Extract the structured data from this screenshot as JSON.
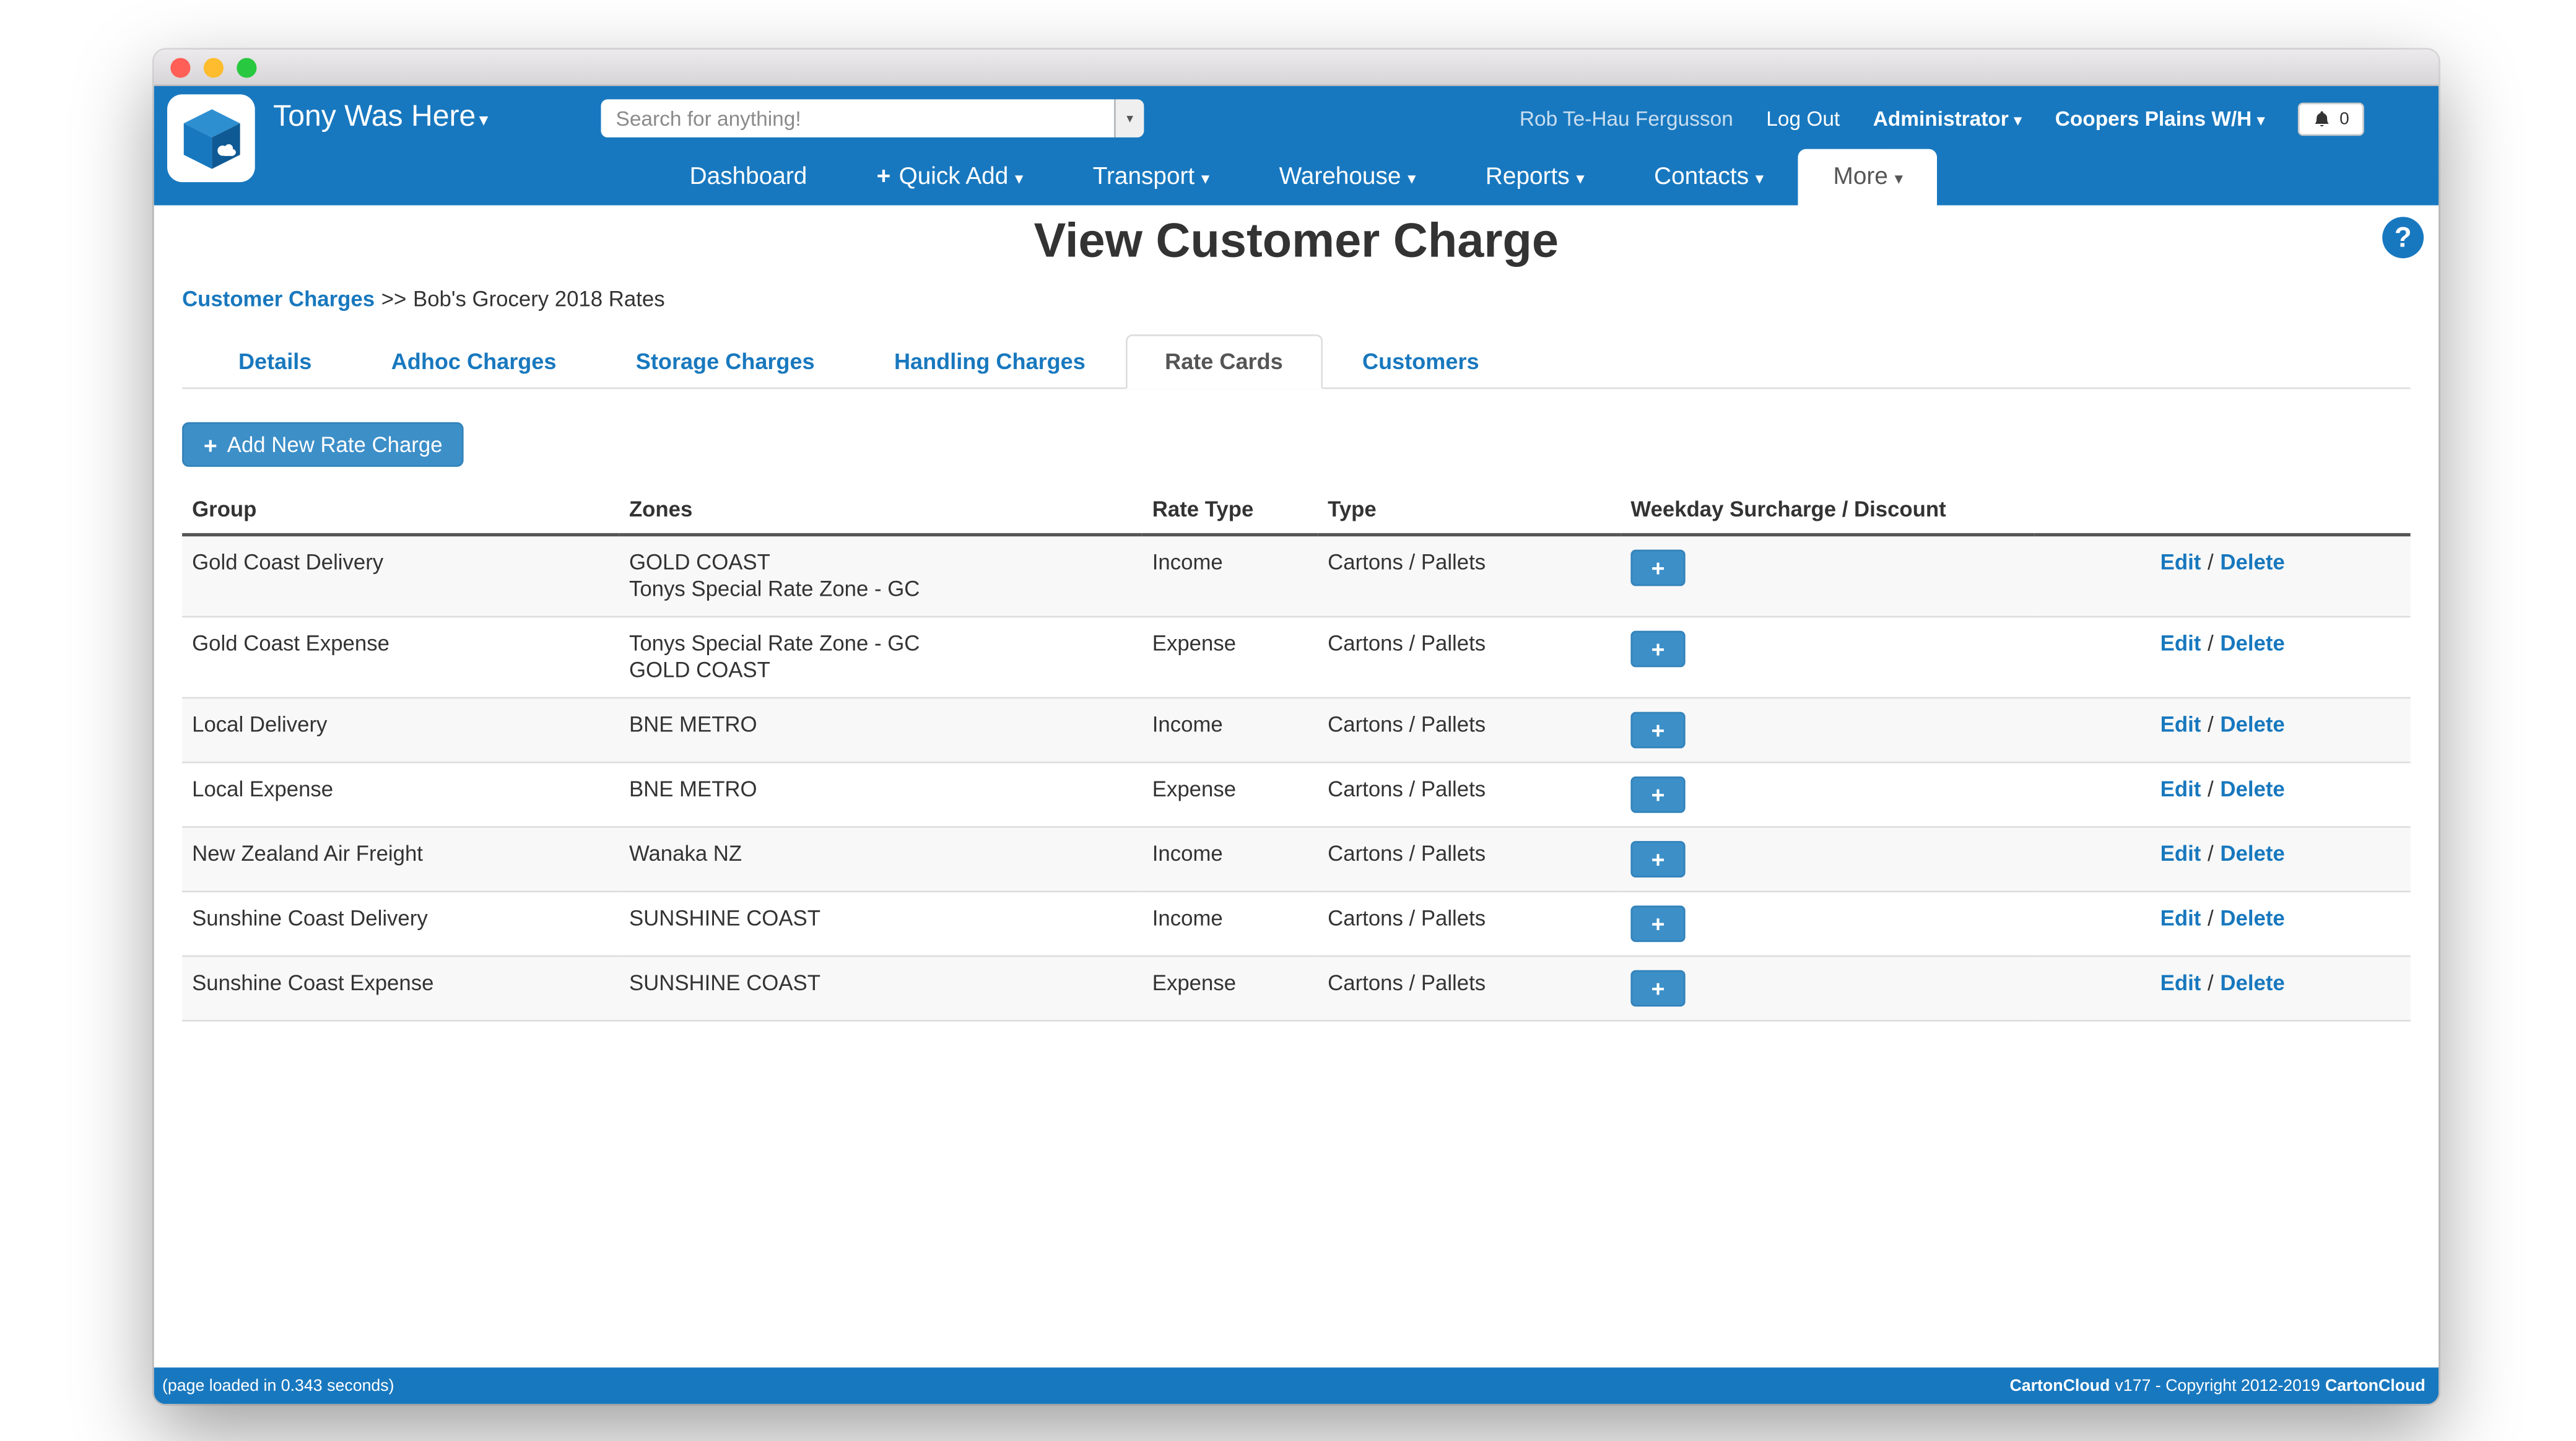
{
  "icons": {
    "caret_down": "▾",
    "plus": "+",
    "question_mark": "?"
  },
  "colors": {
    "header_blue": "#1878bf",
    "link_blue": "#1878be",
    "button_blue": "#3d8fc8"
  },
  "header": {
    "brand": "Tony Was Here",
    "search_placeholder": "Search for anything!",
    "user_name": "Rob Te-Hau Fergusson",
    "log_out_label": "Log Out",
    "role_label": "Administrator",
    "warehouse_label": "Coopers Plains W/H",
    "notification_count": "0"
  },
  "nav": {
    "items": [
      {
        "label": "Dashboard"
      },
      {
        "label": "Quick Add"
      },
      {
        "label": "Transport"
      },
      {
        "label": "Warehouse"
      },
      {
        "label": "Reports"
      },
      {
        "label": "Contacts"
      },
      {
        "label": "More"
      }
    ]
  },
  "page": {
    "title": "View Customer Charge",
    "breadcrumb": {
      "link": "Customer Charges",
      "separator": ">>",
      "current": "Bob's Grocery 2018 Rates"
    },
    "tabs": [
      {
        "label": "Details"
      },
      {
        "label": "Adhoc Charges"
      },
      {
        "label": "Storage Charges"
      },
      {
        "label": "Handling Charges"
      },
      {
        "label": "Rate Cards"
      },
      {
        "label": "Customers"
      }
    ],
    "add_button_label": "Add New Rate Charge",
    "table": {
      "headers": [
        "Group",
        "Zones",
        "Rate Type",
        "Type",
        "Weekday Surcharge / Discount",
        ""
      ],
      "rows": [
        {
          "group": "Gold Coast Delivery",
          "zones": [
            "GOLD COAST",
            "Tonys Special Rate Zone - GC"
          ],
          "rate_type": "Income",
          "type": "Cartons / Pallets"
        },
        {
          "group": "Gold Coast Expense",
          "zones": [
            "Tonys Special Rate Zone - GC",
            "GOLD COAST"
          ],
          "rate_type": "Expense",
          "type": "Cartons / Pallets"
        },
        {
          "group": "Local Delivery",
          "zones": [
            "BNE METRO"
          ],
          "rate_type": "Income",
          "type": "Cartons / Pallets"
        },
        {
          "group": "Local Expense",
          "zones": [
            "BNE METRO"
          ],
          "rate_type": "Expense",
          "type": "Cartons / Pallets"
        },
        {
          "group": "New Zealand Air Freight",
          "zones": [
            "Wanaka NZ"
          ],
          "rate_type": "Income",
          "type": "Cartons / Pallets"
        },
        {
          "group": "Sunshine Coast Delivery",
          "zones": [
            "SUNSHINE COAST"
          ],
          "rate_type": "Income",
          "type": "Cartons / Pallets"
        },
        {
          "group": "Sunshine Coast Expense",
          "zones": [
            "SUNSHINE COAST"
          ],
          "rate_type": "Expense",
          "type": "Cartons / Pallets"
        }
      ],
      "actions": {
        "edit": "Edit",
        "separator": "/",
        "delete": "Delete"
      }
    }
  },
  "footer": {
    "left": "(page loaded in 0.343 seconds)",
    "brand": "CartonCloud",
    "middle": "v177 - Copyright 2012-2019",
    "brand2": "CartonCloud"
  }
}
